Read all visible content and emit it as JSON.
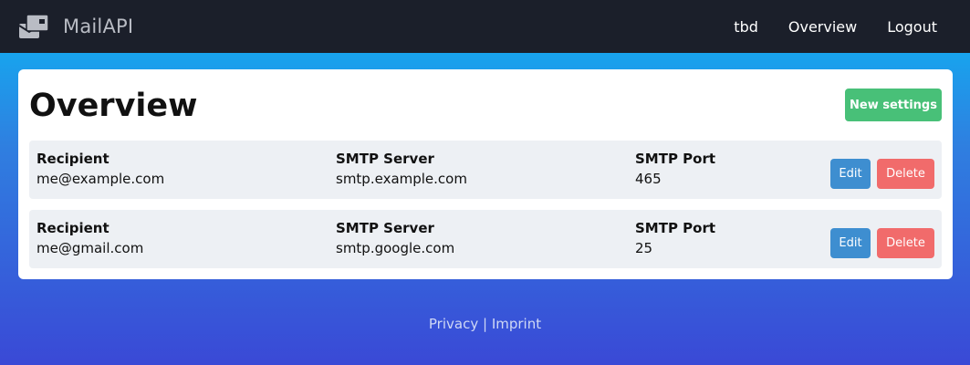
{
  "brand": {
    "name": "MailAPI",
    "icon": "mail-cards-icon"
  },
  "nav": {
    "items": [
      "tbd",
      "Overview",
      "Logout"
    ]
  },
  "page": {
    "title": "Overview",
    "new_button": "New settings"
  },
  "rows": [
    {
      "recipient_label": "Recipient",
      "recipient": "me@example.com",
      "server_label": "SMTP Server",
      "server": "smtp.example.com",
      "port_label": "SMTP Port",
      "port": "465",
      "edit": "Edit",
      "delete": "Delete"
    },
    {
      "recipient_label": "Recipient",
      "recipient": "me@gmail.com",
      "server_label": "SMTP Server",
      "server": "smtp.google.com",
      "port_label": "SMTP Port",
      "port": "25",
      "edit": "Edit",
      "delete": "Delete"
    }
  ],
  "footer": {
    "privacy": "Privacy",
    "separator": "|",
    "imprint": "Imprint"
  },
  "colors": {
    "navbar": "#1b1f2a",
    "success": "#48c078",
    "info": "#3e8ed0",
    "danger": "#f16b6b",
    "row_bg": "#edf0f4"
  }
}
